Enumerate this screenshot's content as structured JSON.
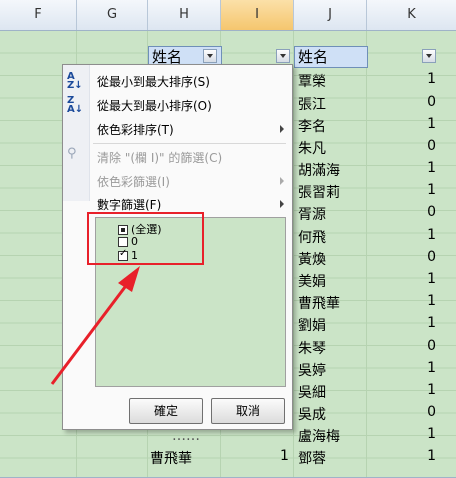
{
  "columns": [
    "F",
    "G",
    "H",
    "I",
    "J",
    "K"
  ],
  "header_cells": {
    "h": "姓名",
    "j": "姓名"
  },
  "k_values": [
    "1",
    "0",
    "1",
    "0",
    "1",
    "1",
    "0",
    "1",
    "0",
    "1",
    "1",
    "1",
    "0",
    "1",
    "1",
    "0",
    "1",
    "1"
  ],
  "j_names": [
    "覃榮",
    "張江",
    "李名",
    "朱凡",
    "胡滿海",
    "張習莉",
    "胥源",
    "何飛",
    "黃煥",
    "美娟",
    "曹飛華",
    "劉娟",
    "朱琴",
    "吳婷",
    "吳細",
    "吳成",
    "盧海梅",
    "鄧蓉"
  ],
  "bottom_row": {
    "h": "曹飛華",
    "i": "1",
    "h_partial": "……"
  },
  "menu": {
    "sort_asc": "從最小到最大排序(S)",
    "sort_desc": "從最大到最小排序(O)",
    "sort_color": "依色彩排序(T)",
    "clear_filter": "清除 \"(欄 I)\" 的篩選(C)",
    "filter_color": "依色彩篩選(I)",
    "number_filter": "數字篩選(F)"
  },
  "filter_list": [
    {
      "label": "(全選)",
      "state": "partial"
    },
    {
      "label": "0",
      "state": "unchecked"
    },
    {
      "label": "1",
      "state": "checked"
    }
  ],
  "buttons": {
    "ok": "確定",
    "cancel": "取消"
  },
  "colors": {
    "annotation": "#e8202a",
    "header_fill": "#cfe0f6",
    "sheet_bg": "#cbe4c7"
  }
}
